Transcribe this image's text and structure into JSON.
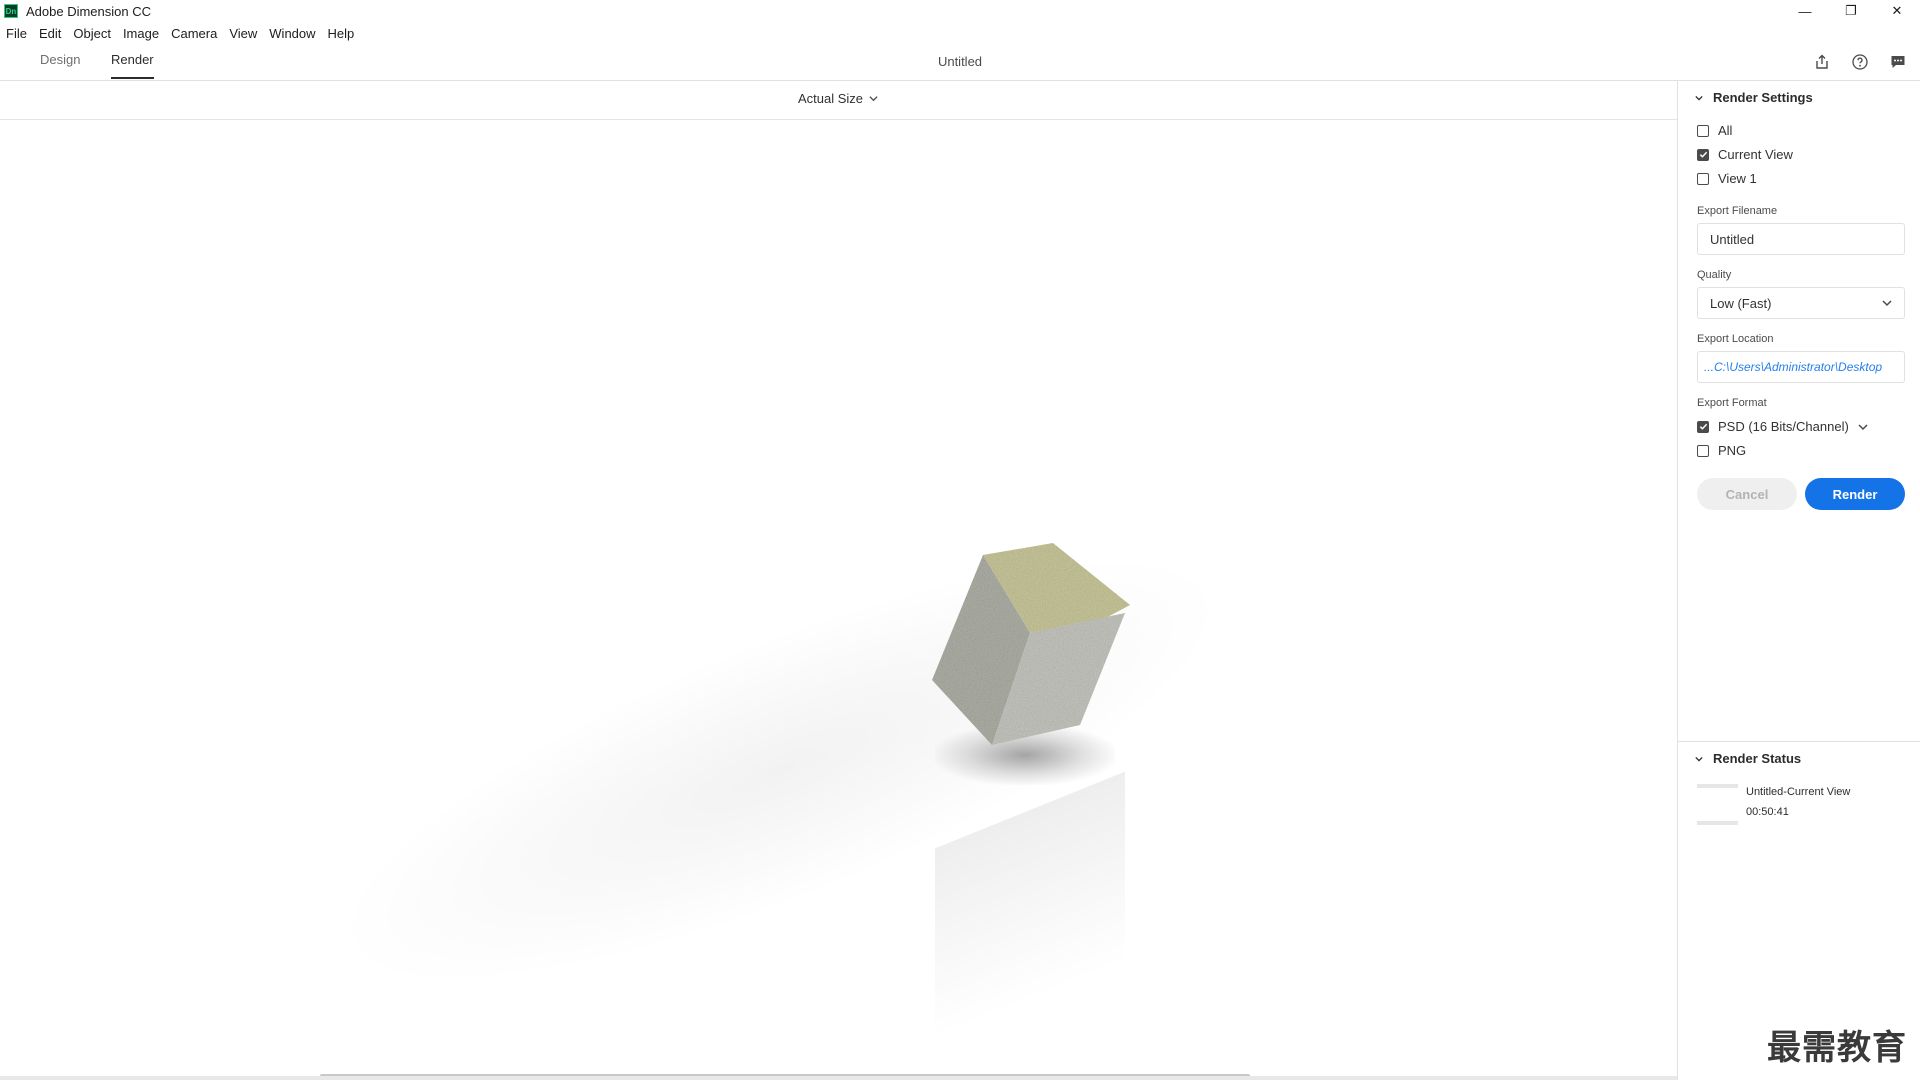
{
  "window": {
    "app_title": "Adobe Dimension CC",
    "logo_text": "Dn",
    "controls": {
      "minimize": "—",
      "restore": "❐",
      "close": "✕"
    }
  },
  "menu": [
    "File",
    "Edit",
    "Object",
    "Image",
    "Camera",
    "View",
    "Window",
    "Help"
  ],
  "tabs": {
    "design": "Design",
    "render": "Render",
    "active": "Render"
  },
  "document_title": "Untitled",
  "canvas_toolbar": {
    "zoom_label": "Actual Size"
  },
  "render_settings": {
    "title": "Render Settings",
    "views": [
      {
        "label": "All",
        "checked": false
      },
      {
        "label": "Current View",
        "checked": true
      },
      {
        "label": "View 1",
        "checked": false
      }
    ],
    "export_filename_label": "Export Filename",
    "export_filename_value": "Untitled",
    "quality_label": "Quality",
    "quality_value": "Low (Fast)",
    "export_location_label": "Export Location",
    "export_location_value": "...C:\\Users\\Administrator\\Desktop",
    "export_format_label": "Export Format",
    "formats": [
      {
        "label": "PSD (16 Bits/Channel)",
        "checked": true,
        "has_dropdown": true
      },
      {
        "label": "PNG",
        "checked": false,
        "has_dropdown": false
      }
    ],
    "cancel_label": "Cancel",
    "render_label": "Render"
  },
  "render_status": {
    "title": "Render Status",
    "item_name": "Untitled-Current View",
    "item_time": "00:50:41"
  },
  "watermark": "最需教育",
  "colors": {
    "accent": "#1473e6",
    "link": "#2680eb"
  }
}
